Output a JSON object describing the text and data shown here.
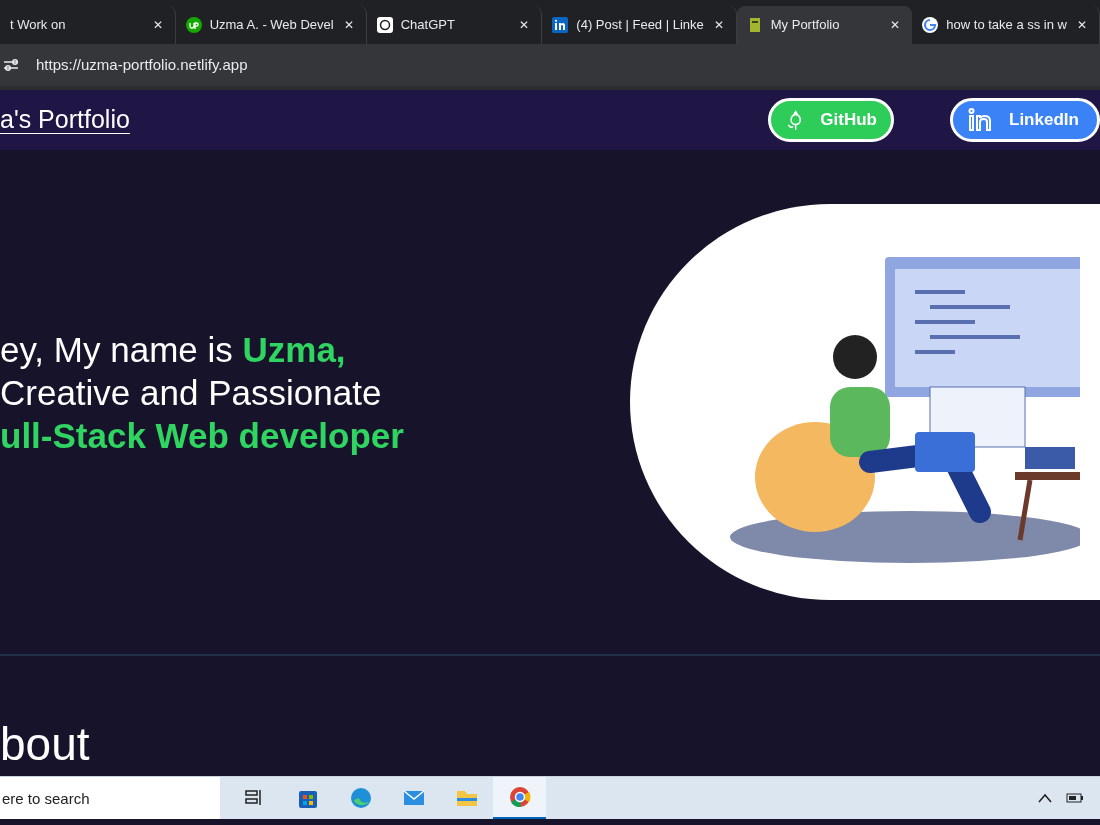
{
  "browser": {
    "tabs": [
      {
        "label": "t Work on",
        "kind": "plain",
        "selected": false
      },
      {
        "label": "Uzma A. - Web Devel",
        "kind": "upwork",
        "selected": false
      },
      {
        "label": "ChatGPT",
        "kind": "chat",
        "selected": false
      },
      {
        "label": "(4) Post | Feed | Linke",
        "kind": "linkedin",
        "selected": false
      },
      {
        "label": "My Portfolio",
        "kind": "page",
        "selected": true
      },
      {
        "label": "how to take a ss in w",
        "kind": "google",
        "selected": false
      }
    ],
    "tab_close": "✕",
    "url": "https://uzma-portfolio.netlify.app"
  },
  "site_nav": {
    "brand": "a's Portfolio",
    "buttons": [
      {
        "label": "GitHub",
        "kind": "github"
      },
      {
        "label": "LinkedIn",
        "kind": "linkedin"
      }
    ]
  },
  "hero": {
    "lines": [
      [
        {
          "text": "ey, My name is ",
          "accent": false
        },
        {
          "text": "Uzma,",
          "accent": true
        }
      ],
      [
        {
          "text": "Creative and Passionate",
          "accent": false
        }
      ],
      [
        {
          "text": "ull-Stack Web developer",
          "accent": true
        }
      ]
    ]
  },
  "next_section": {
    "heading": "bout"
  },
  "taskbar": {
    "search": {
      "placeholder": "ere to search"
    },
    "apps": [
      {
        "kind": "taskview",
        "active": false
      },
      {
        "kind": "store",
        "active": false
      },
      {
        "kind": "edge",
        "active": false
      },
      {
        "kind": "mail",
        "active": false
      },
      {
        "kind": "folder",
        "active": false
      },
      {
        "kind": "chrome",
        "active": true
      }
    ]
  }
}
